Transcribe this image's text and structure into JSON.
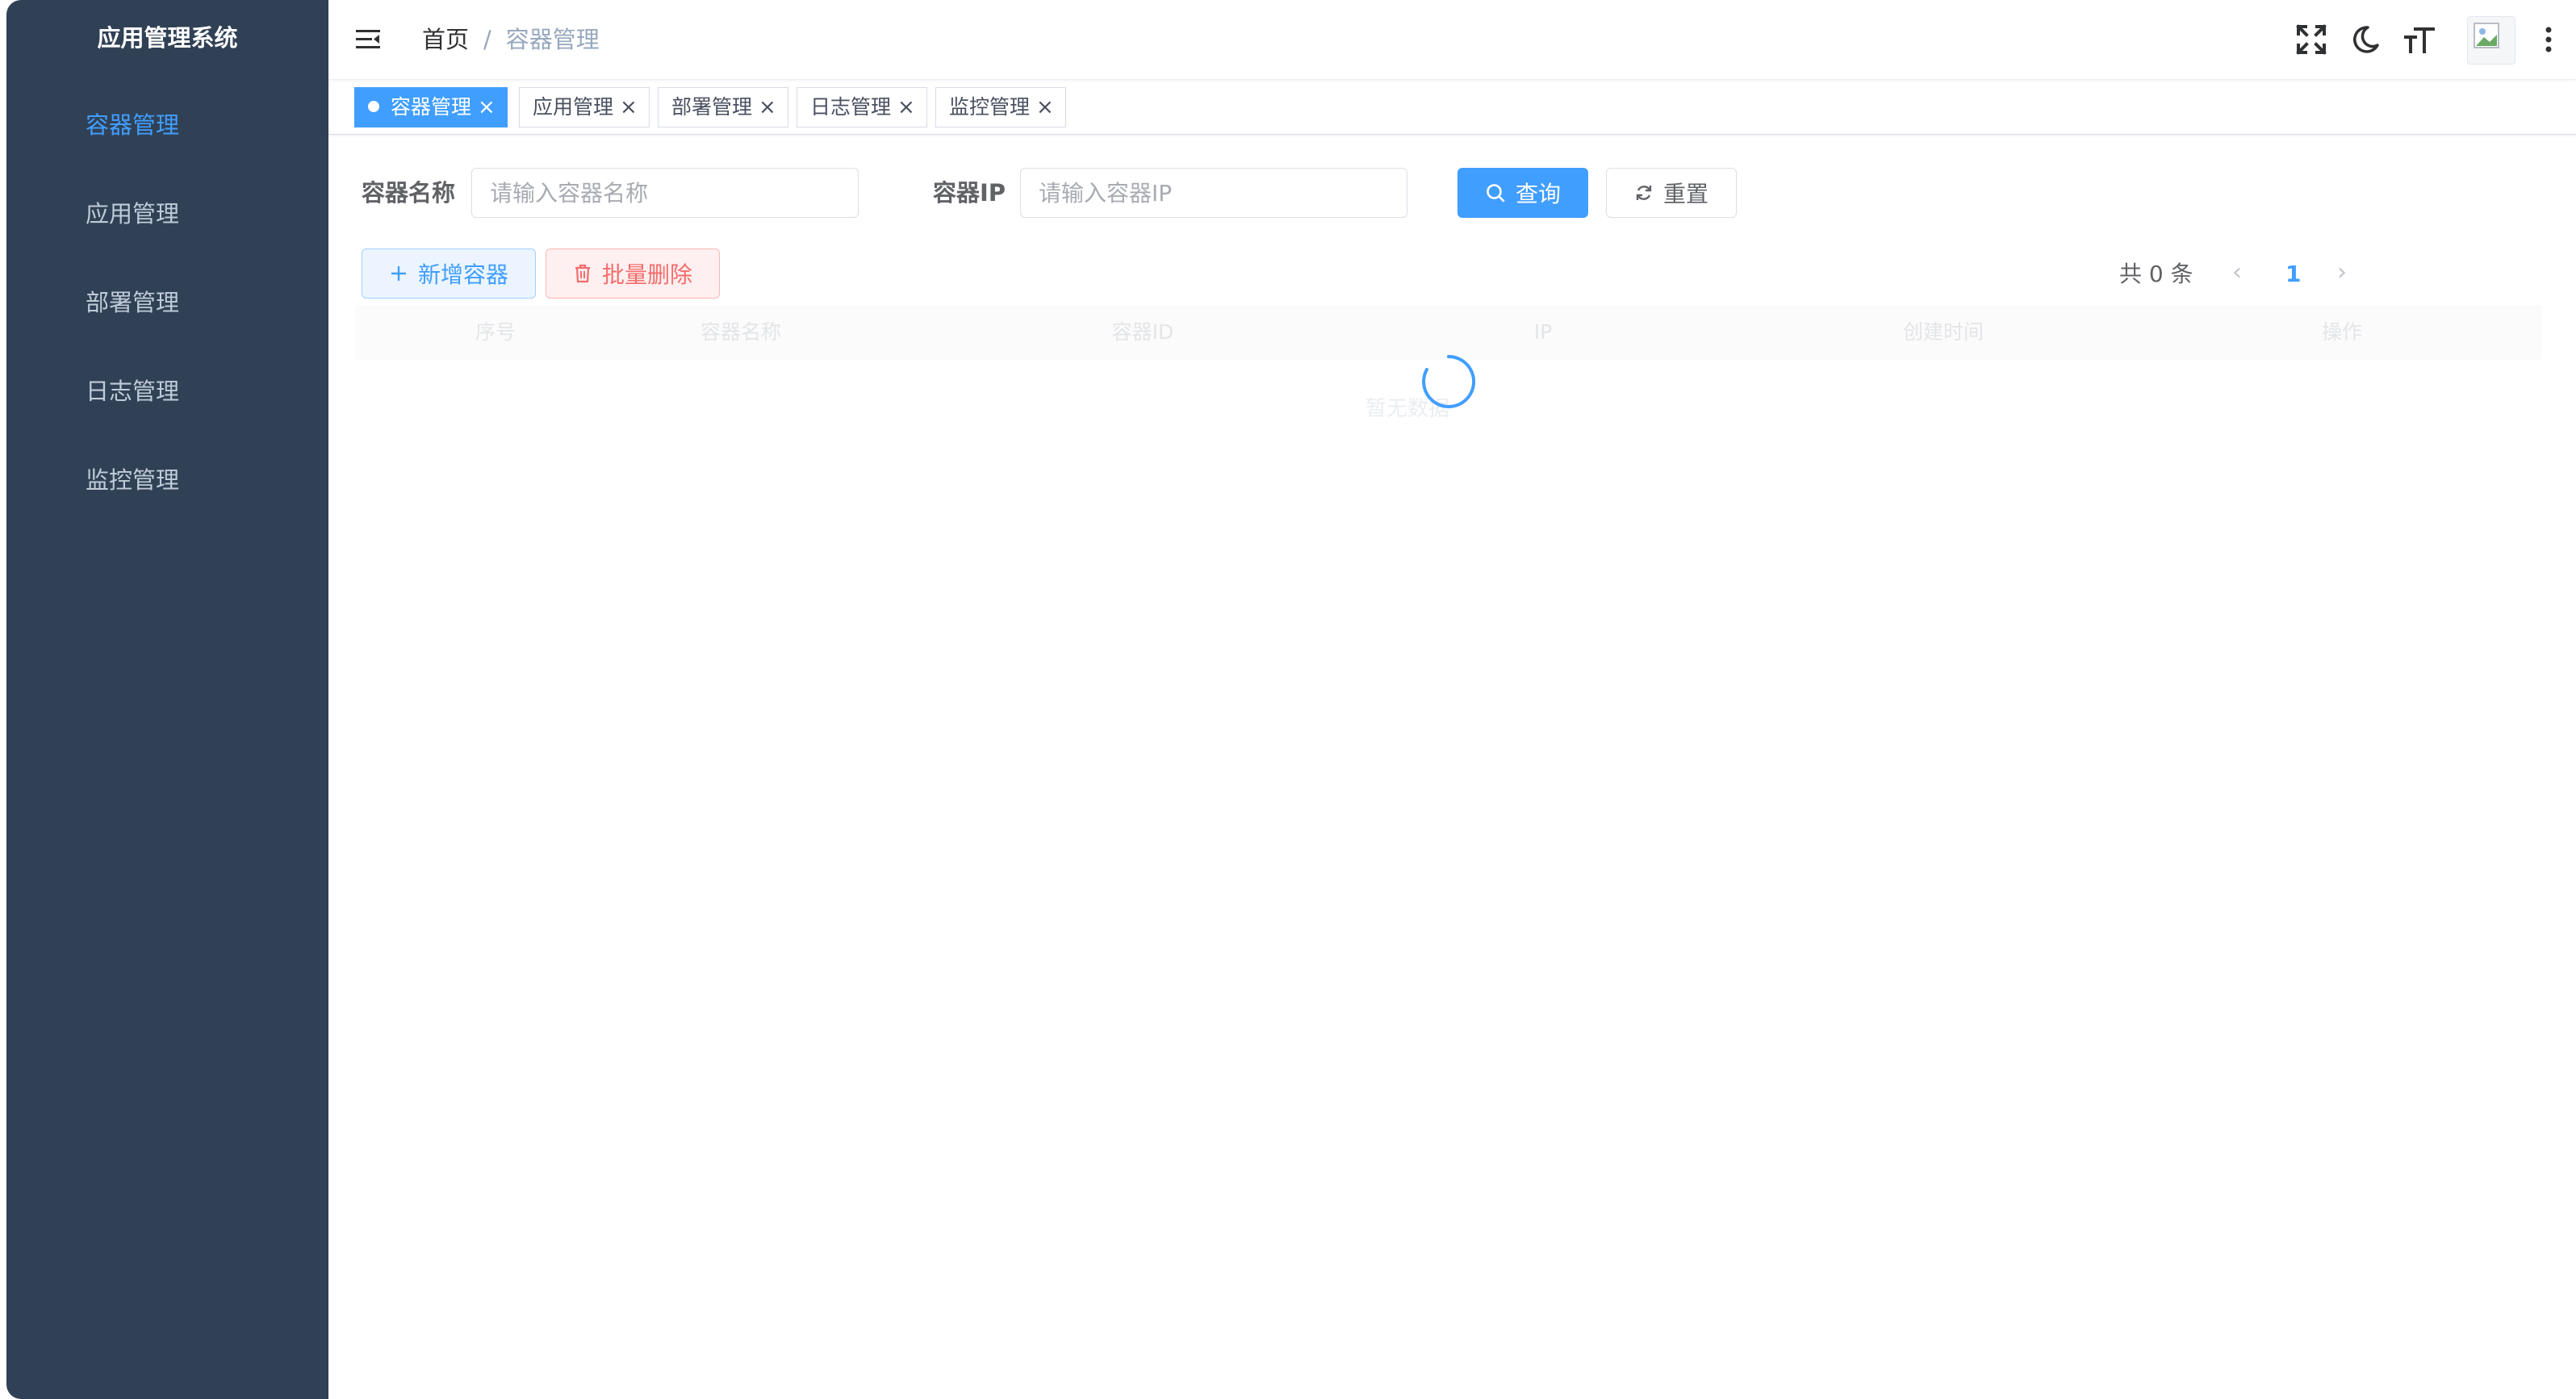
{
  "app": {
    "title": "应用管理系统"
  },
  "sidebar": {
    "items": [
      {
        "label": "容器管理",
        "active": true
      },
      {
        "label": "应用管理",
        "active": false
      },
      {
        "label": "部署管理",
        "active": false
      },
      {
        "label": "日志管理",
        "active": false
      },
      {
        "label": "监控管理",
        "active": false
      }
    ]
  },
  "header": {
    "breadcrumb": {
      "home": "首页",
      "separator": "/",
      "current": "容器管理"
    },
    "icons": [
      "hamburger-icon",
      "fullscreen-icon",
      "moon-icon",
      "font-size-icon",
      "avatar",
      "more-vertical-icon"
    ]
  },
  "tags": [
    {
      "label": "容器管理",
      "active": true,
      "close": "×"
    },
    {
      "label": "应用管理",
      "active": false,
      "close": "×"
    },
    {
      "label": "部署管理",
      "active": false,
      "close": "×"
    },
    {
      "label": "日志管理",
      "active": false,
      "close": "×"
    },
    {
      "label": "监控管理",
      "active": false,
      "close": "×"
    }
  ],
  "search": {
    "name_label": "容器名称",
    "name_placeholder": "请输入容器名称",
    "ip_label": "容器IP",
    "ip_placeholder": "请输入容器IP",
    "query_label": "查询",
    "reset_label": "重置"
  },
  "actions": {
    "add_label": "新增容器",
    "batch_delete_label": "批量删除"
  },
  "pagination": {
    "total_text": "共 0 条",
    "prev": "‹",
    "current_page": "1",
    "next": "›"
  },
  "table": {
    "columns": [
      "序号",
      "容器名称",
      "容器ID",
      "IP",
      "创建时间",
      "操作"
    ],
    "empty_text": "暂无数据",
    "loading": true
  },
  "colors": {
    "sidebar_bg": "#304156",
    "sidebar_text": "#bfcbd9",
    "accent": "#409eff",
    "danger": "#f56c6c"
  }
}
